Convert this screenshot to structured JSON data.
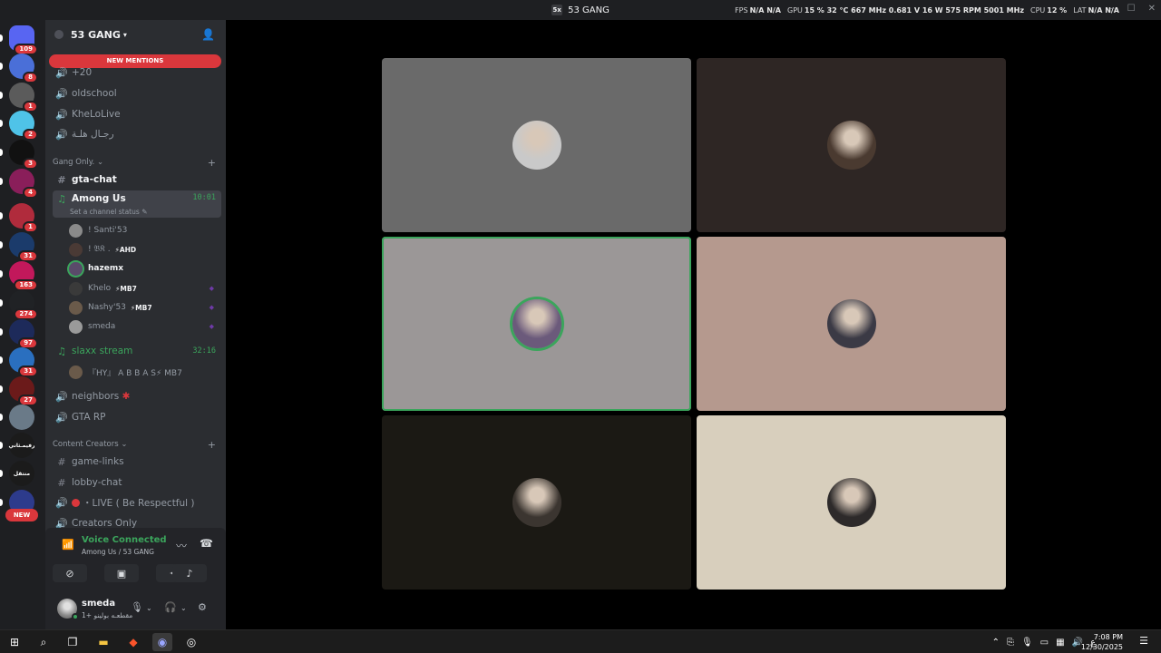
{
  "window": {
    "title": "53 GANG",
    "title_icon": "5x"
  },
  "perf": {
    "fps_label": "FPS",
    "fps": "N/A",
    "fps2": "N/A",
    "gpu_label": "GPU",
    "gpu": "15 % 32 °C 667 MHz 0.681 V 16 W 575 RPM 5001 MHz",
    "cpu_label": "CPU",
    "cpu": "12 %",
    "lat_label": "LAT",
    "lat": "N/A",
    "lat2": "N/A"
  },
  "servers": [
    {
      "badge": "109",
      "color": "#5865f2"
    },
    {
      "badge": "8",
      "color": "#4a6fd8"
    },
    {
      "badge": "1",
      "color": "#5b5b5b"
    },
    {
      "badge": "2",
      "color": "#4fc3e8"
    },
    {
      "badge": "3",
      "color": "#111111"
    },
    {
      "badge": "4",
      "color": "#8a1e5a"
    },
    {
      "badge": "1",
      "color": "#b02b3c"
    },
    {
      "badge": "31",
      "color": "#1b3b6b"
    },
    {
      "badge": "163",
      "color": "#c2185b"
    },
    {
      "badge": "274",
      "color": "#202225"
    },
    {
      "badge": "97",
      "color": "#1d2a5a"
    },
    {
      "badge": "31",
      "color": "#2a6fbf"
    },
    {
      "badge": "27",
      "color": "#6b1a1a"
    },
    {
      "badge": "",
      "color": "#6a7a88"
    },
    {
      "badge": "",
      "color": "#1b1b1b",
      "label": "رفيمـثاني"
    },
    {
      "badge": "",
      "color": "#1b1b1b",
      "label": "منتقل"
    },
    {
      "badge": "",
      "color": "#2d3b8c"
    }
  ],
  "new_badge": "NEW",
  "guild": {
    "name": "53 GANG",
    "new_mentions": "NEW MENTIONS"
  },
  "channels_top": [
    {
      "name": "+20"
    },
    {
      "name": "oldschool"
    },
    {
      "name": "KheLoLive"
    },
    {
      "name": "رجـال هلـة"
    }
  ],
  "category_gang": "Gang Only.",
  "gta_chat": "gta-chat",
  "among_us": {
    "name": "Among Us",
    "timer": "10:01",
    "status": "Set a channel status"
  },
  "voice_users": [
    {
      "name": "! Santi'53",
      "tag": "",
      "speaking": false,
      "color": "#8a8a8a"
    },
    {
      "name": "! 𝔅𝔎 .",
      "tag": "⚡AHD",
      "speaking": false,
      "color": "#4a3a35"
    },
    {
      "name": "hazemx",
      "tag": "",
      "speaking": true,
      "color": "#5a4a6a"
    },
    {
      "name": "Khelo",
      "tag": "⚡MB7",
      "speaking": false,
      "color": "#3a3a3a"
    },
    {
      "name": "Nashy'53",
      "tag": "⚡MB7",
      "speaking": false,
      "color": "#6a5a4a"
    },
    {
      "name": "smeda",
      "tag": "",
      "speaking": false,
      "color": "#9a9a9a"
    }
  ],
  "slaxx": {
    "name": "slaxx stream",
    "timer": "32:16",
    "user": "『HY』 A B B A S⚡ MB7"
  },
  "channels_bottom": [
    {
      "name": "neighbors"
    },
    {
      "name": "GTA RP"
    }
  ],
  "category_creators": "Content Creators",
  "creator_channels": [
    {
      "name": "game-links"
    },
    {
      "name": "lobby-chat"
    },
    {
      "name": "・LIVE ( Be Respectful )"
    },
    {
      "name": "Creators Only"
    }
  ],
  "voice_panel": {
    "title": "Voice Connected",
    "subtitle": "Among Us / 53 GANG"
  },
  "user": {
    "name": "smeda",
    "status": "مقطعـه بولينو +1"
  },
  "tiles": [
    {
      "bg": "#6a6a6a",
      "avatar": "#c9c9c9",
      "speaking": false
    },
    {
      "bg": "#2e2624",
      "avatar": "#4a3a30",
      "speaking": false
    },
    {
      "bg": "#9b9797",
      "avatar": "#6b5a7b",
      "speaking": true
    },
    {
      "bg": "#b5998e",
      "avatar": "#3b3a45",
      "speaking": false
    },
    {
      "bg": "#1b1914",
      "avatar": "#3b3530",
      "speaking": false
    },
    {
      "bg": "#d8cfbd",
      "avatar": "#2d2a2a",
      "speaking": false
    }
  ],
  "taskbar": {
    "time": "7:08 PM",
    "date": "12/30/2025",
    "lang": "ع"
  },
  "accent": {
    "green": "#3ba55c",
    "red": "#da373c"
  }
}
